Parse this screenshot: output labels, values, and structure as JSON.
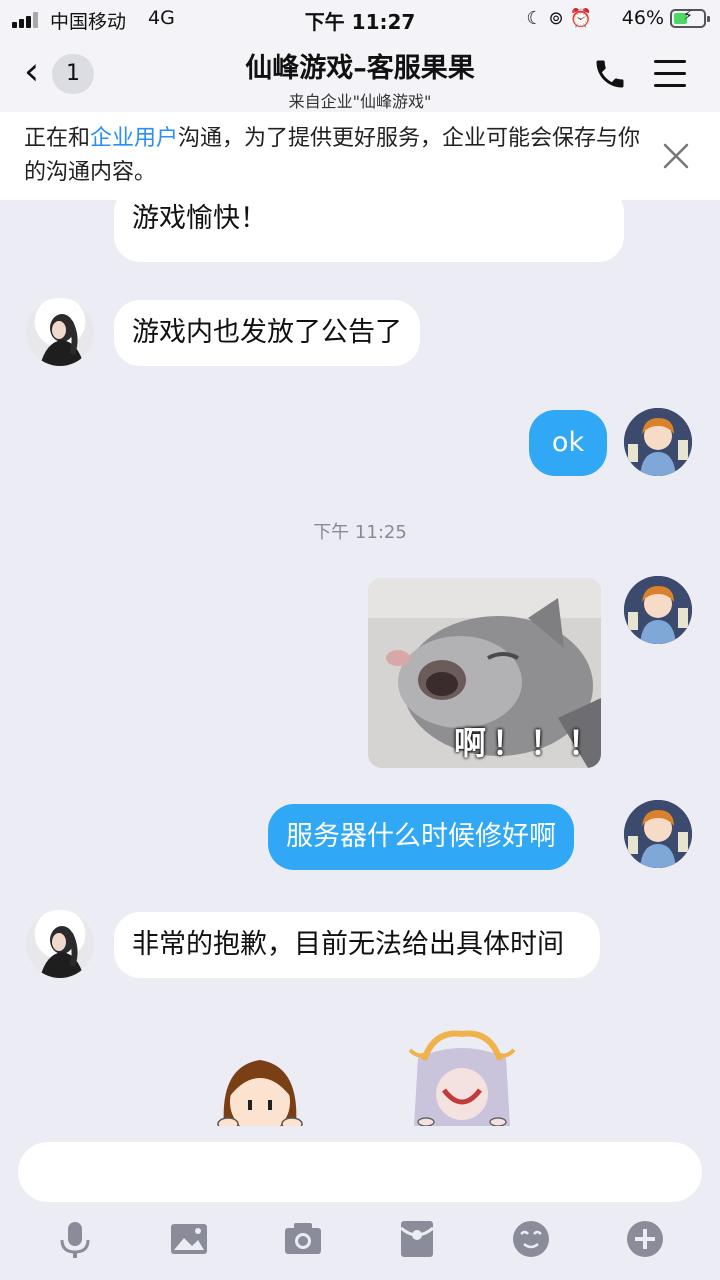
{
  "status_bar": {
    "carrier": "中国移动",
    "network": "4G",
    "time": "下午 11:27",
    "battery_percent": "46%",
    "battery_level": 0.46,
    "battery_color": "#4cd964"
  },
  "header": {
    "back_badge": "1",
    "title": "仙峰游戏–客服果果",
    "subtitle": "来自企业\"仙峰游戏\"",
    "icons": [
      "back-chevron-icon",
      "phone-icon",
      "menu-icon"
    ]
  },
  "notice": {
    "prefix": "正在和",
    "link": "企业用户",
    "suffix": "沟通，为了提供更好服务，企业可能会保存与你的沟通内容。",
    "link_color": "#2a8ef5"
  },
  "messages": {
    "m0": {
      "sender": "agent",
      "text": "游戏愉快！"
    },
    "m1": {
      "sender": "agent",
      "text": "游戏内也发放了公告了"
    },
    "m2": {
      "sender": "me",
      "text": "ok"
    },
    "timestamp": "下午 11:25",
    "m3": {
      "sender": "me",
      "type": "sticker",
      "caption": "啊！！！"
    },
    "m4": {
      "sender": "me",
      "text": "服务器什么时候修好啊"
    },
    "m5": {
      "sender": "agent",
      "text": "非常的抱歉，目前无法给出具体时间"
    }
  },
  "colors": {
    "outgoing_bubble": "#31a8f5",
    "incoming_bubble": "#ffffff",
    "background": "#ececf4"
  },
  "toolbar": {
    "icons": [
      "microphone-icon",
      "image-icon",
      "camera-icon",
      "red-packet-icon",
      "emoji-icon",
      "plus-icon"
    ]
  }
}
